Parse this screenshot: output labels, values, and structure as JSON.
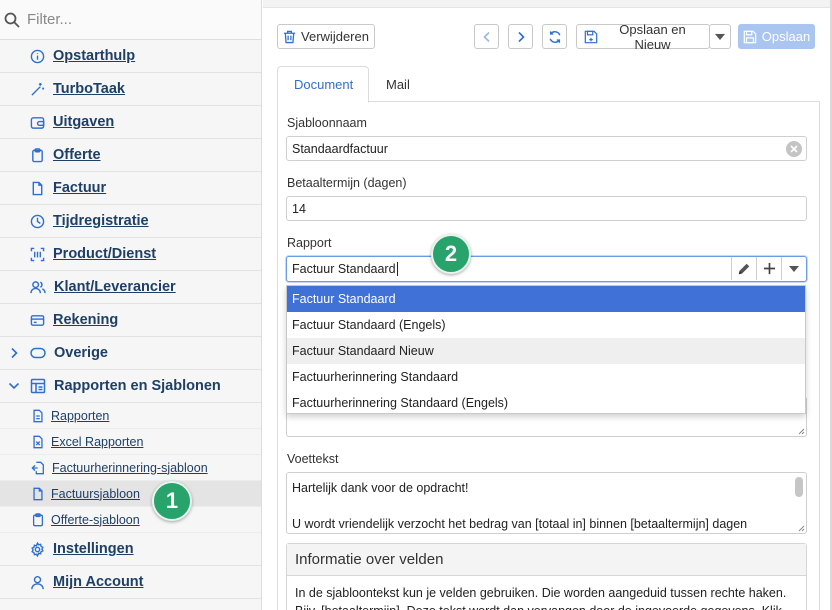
{
  "sidebar": {
    "filter_placeholder": "Filter...",
    "items": [
      {
        "label": "Opstarthulp",
        "icon": "info-icon"
      },
      {
        "label": "TurboTaak",
        "icon": "magic-wand-icon"
      },
      {
        "label": "Uitgaven",
        "icon": "wallet-icon"
      },
      {
        "label": "Offerte",
        "icon": "clipboard-icon"
      },
      {
        "label": "Factuur",
        "icon": "document-icon"
      },
      {
        "label": "Tijdregistratie",
        "icon": "clock-icon"
      },
      {
        "label": "Product/Dienst",
        "icon": "barcode-icon"
      },
      {
        "label": "Klant/Leverancier",
        "icon": "users-icon"
      },
      {
        "label": "Rekening",
        "icon": "credit-card-icon"
      }
    ],
    "overige_label": "Overige",
    "rapporten_label": "Rapporten en Sjablonen",
    "sub_items": [
      {
        "label": "Rapporten",
        "icon": "report-icon"
      },
      {
        "label": "Excel Rapporten",
        "icon": "excel-icon"
      },
      {
        "label": "Factuurherinnering-sjabloon",
        "icon": "reminder-icon"
      },
      {
        "label": "Factuursjabloon",
        "icon": "document-icon",
        "active": true
      },
      {
        "label": "Offerte-sjabloon",
        "icon": "clipboard-icon"
      }
    ],
    "bottom_items": [
      {
        "label": "Instellingen",
        "icon": "gear-icon"
      },
      {
        "label": "Mijn Account",
        "icon": "user-icon"
      }
    ]
  },
  "badges": {
    "one": "1",
    "two": "2"
  },
  "toolbar": {
    "delete_label": "Verwijderen",
    "save_new_label": "Opslaan en Nieuw",
    "save_label": "Opslaan"
  },
  "tabs": [
    {
      "label": "Document",
      "active": true
    },
    {
      "label": "Mail",
      "active": false
    }
  ],
  "form": {
    "template_name_label": "Sjabloonnaam",
    "template_name_value": "Standaardfactuur",
    "payment_term_label": "Betaaltermijn (dagen)",
    "payment_term_value": "14",
    "report_label": "Rapport",
    "report_value": "Factuur Standaard",
    "report_options": [
      "Factuur Standaard",
      "Factuur Standaard (Engels)",
      "Factuur Standaard Nieuw",
      "Factuurherinnering Standaard",
      "Factuurherinnering Standaard (Engels)"
    ],
    "footer_label": "Voettekst",
    "footer_line1": "Hartelijk dank voor de opdracht!",
    "footer_line2": "U wordt vriendelijk verzocht het bedrag van [totaal in] binnen [betaaltermijn] dagen"
  },
  "info": {
    "title": "Informatie over velden",
    "line1": "In de sjabloontekst kun je velden gebruiken. Die worden aangeduid tussen rechte haken.",
    "line2": "Bijv. [betaaltermijn]. Deze tekst wordt dan vervangen door de ingevoerde gegevens. Klik"
  },
  "colors": {
    "accent": "#2f6fd0",
    "nav_text": "#1e3f66",
    "badge": "#27a36b",
    "selected": "#3f71d6"
  }
}
